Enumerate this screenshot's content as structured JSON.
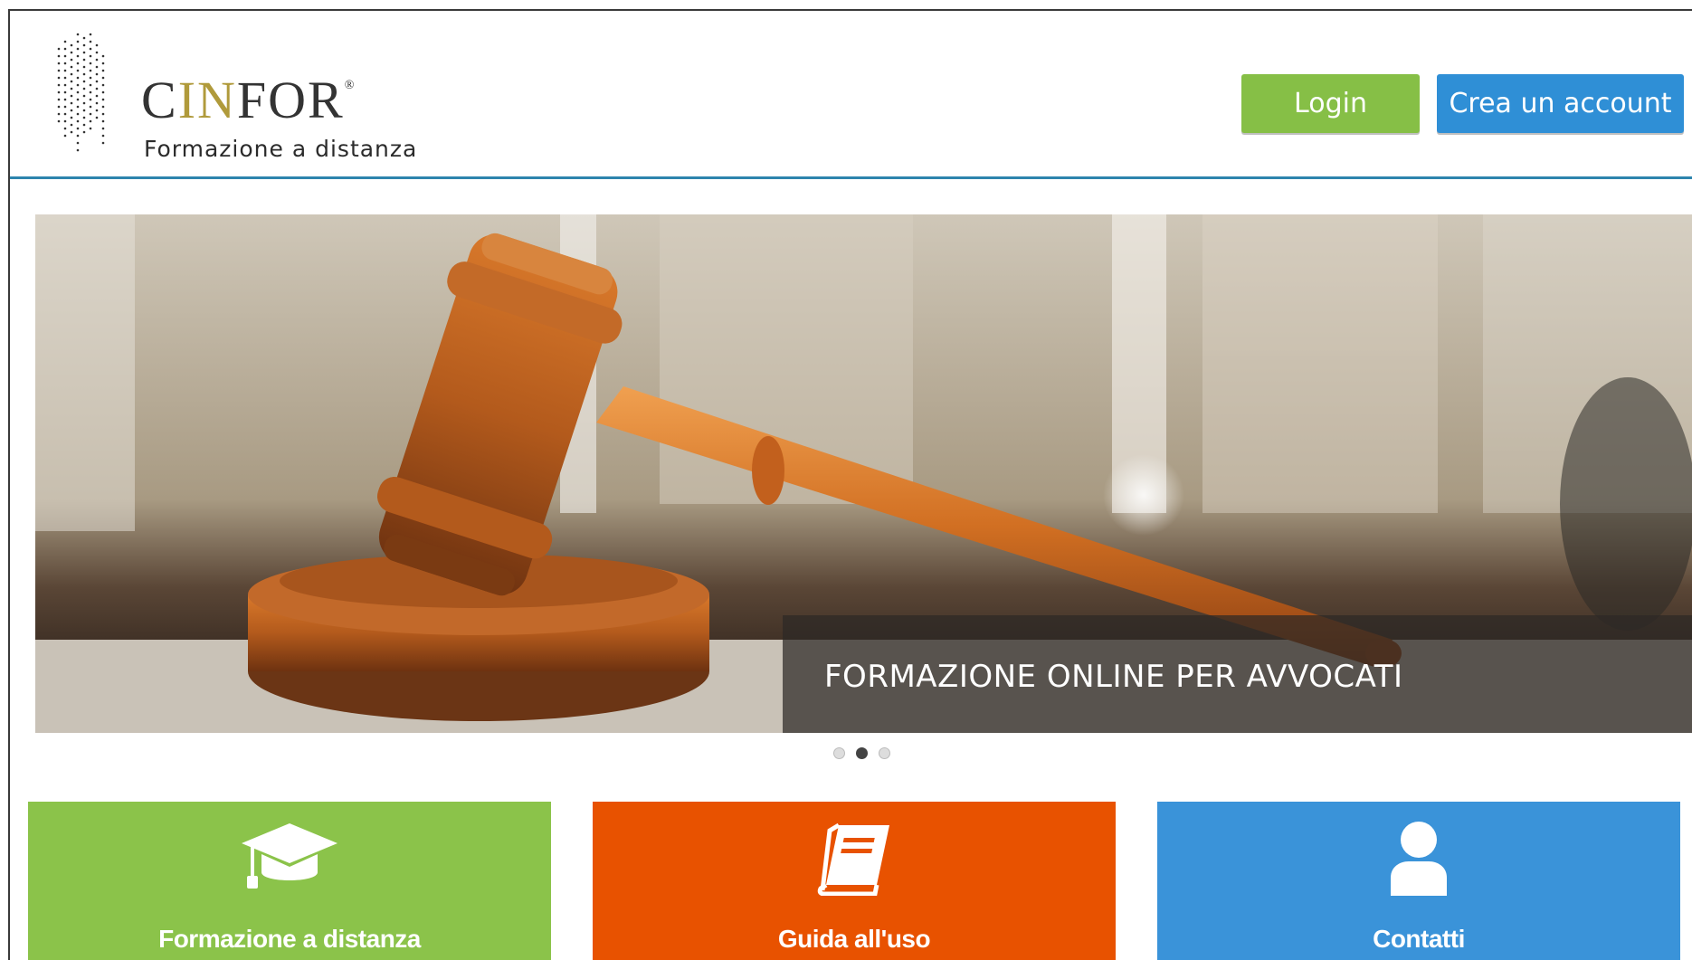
{
  "header": {
    "logo": {
      "name_pre": "C",
      "name_in": "IN",
      "name_post": "FOR",
      "reg": "®",
      "tagline": "Formazione a distanza"
    },
    "login_label": "Login",
    "signup_label": "Crea un account"
  },
  "slider": {
    "caption": "FORMAZIONE ONLINE PER AVVOCATI",
    "slides": 3,
    "active_slide": 2
  },
  "tiles": [
    {
      "label": "Formazione a distanza",
      "icon": "graduation-cap-icon",
      "color": "#8bc34a"
    },
    {
      "label": "Guida all'uso",
      "icon": "book-icon",
      "color": "#e85200"
    },
    {
      "label": "Contatti",
      "icon": "user-icon",
      "color": "#3a93d9"
    }
  ],
  "colors": {
    "accent_line": "#2d84ad",
    "login": "#86bf46",
    "signup": "#2f8fd6"
  }
}
